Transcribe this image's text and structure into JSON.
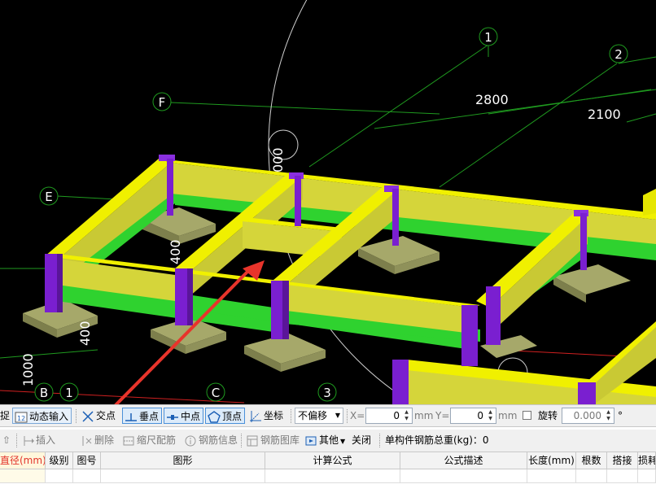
{
  "viewport": {
    "axis_labels": {
      "a1": "1",
      "a2": "2",
      "aF": "F",
      "aE": "E",
      "aB": "B",
      "a1b": "1",
      "aC": "C",
      "a3": "3"
    },
    "dimensions": {
      "d2800": "2800",
      "d2100": "2100",
      "d400a": "400",
      "d400b": "400",
      "d1000": "1000",
      "d000": "000"
    },
    "colors": {
      "beam_top": "#e6e600",
      "beam_side": "#c8c84a",
      "beam_lower": "#2fd22f",
      "column": "#7a1fd0",
      "pad": "#a6a86a",
      "axis_line": "#1f9a1f",
      "arrow": "#e8342b"
    }
  },
  "snapbar": {
    "cut_label": "捉",
    "dynamic_input": "动态输入",
    "intersection": "交点",
    "perpendicular": "垂点",
    "midpoint": "中点",
    "vertex": "顶点",
    "coordinate": "坐标",
    "offset_select": "不偏移",
    "x_label": "X=",
    "x_value": "0",
    "x_unit": "mm",
    "y_label": "Y=",
    "y_value": "0",
    "y_unit": "mm",
    "rotate_label": "旋转",
    "rotate_value": "0.000",
    "degree": "°"
  },
  "toolbar": {
    "insert": "插入",
    "delete": "删除",
    "scale_rebar": "缩尺配筋",
    "rebar_info": "钢筋信息",
    "rebar_library": "钢筋图库",
    "other": "其他",
    "close": "关闭",
    "weight_label": "单构件钢筋总重(kg)：0"
  },
  "grid": {
    "columns": [
      "直径(mm)",
      "级别",
      "图号",
      "图形",
      "计算公式",
      "公式描述",
      "长度(mm)",
      "根数",
      "搭接",
      "损耗"
    ]
  }
}
